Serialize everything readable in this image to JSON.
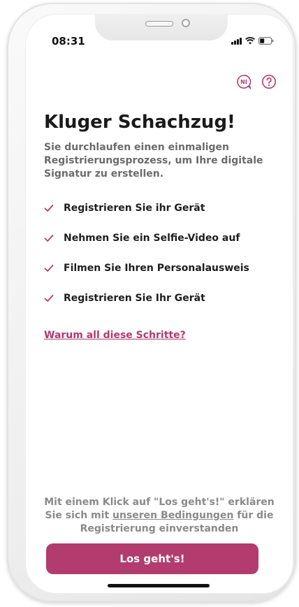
{
  "status_bar": {
    "time": "08:31"
  },
  "header": {
    "language_icon": "language-ni-icon",
    "help_icon": "question-mark-icon"
  },
  "main": {
    "title": "Kluger Schachzug!",
    "intro": "Sie durchlaufen einen einmaligen Registrierungsprozess, um Ihre digitale Signatur zu erstellen.",
    "steps": [
      {
        "label": "Registrieren Sie ihr Gerät",
        "icon": "check-icon"
      },
      {
        "label": "Nehmen Sie ein Selfie-Video auf",
        "icon": "check-icon"
      },
      {
        "label": "Filmen Sie Ihren Personalausweis",
        "icon": "check-icon"
      },
      {
        "label": "Registrieren Sie Ihr Gerät",
        "icon": "check-icon"
      }
    ],
    "why_link": "Warum all diese Schritte?"
  },
  "footer": {
    "consent_before": "Mit einem Klick auf \"Los geht's!\" erklären Sie sich mit ",
    "consent_link": "unseren Bedingungen",
    "consent_after": " für die Registrierung einverstanden",
    "cta_label": "Los geht's!"
  },
  "colors": {
    "accent": "#b23c6d",
    "link": "#b03a6e",
    "check": "#b23c6d"
  }
}
